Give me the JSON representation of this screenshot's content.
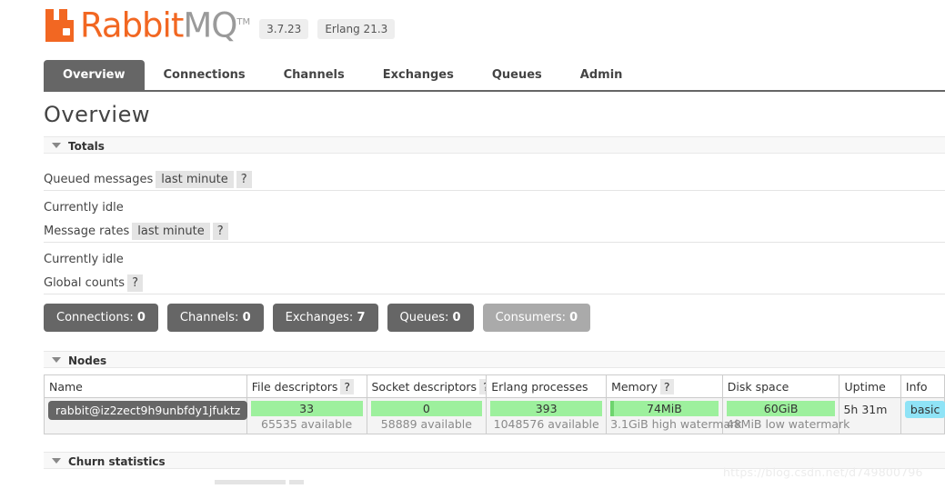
{
  "header": {
    "logo_rabbit": "Rabbit",
    "logo_mq": "MQ",
    "logo_tm": "TM",
    "version": "3.7.23",
    "erlang_version": "Erlang 21.3"
  },
  "tabs": [
    {
      "label": "Overview",
      "active": true
    },
    {
      "label": "Connections",
      "active": false
    },
    {
      "label": "Channels",
      "active": false
    },
    {
      "label": "Exchanges",
      "active": false
    },
    {
      "label": "Queues",
      "active": false
    },
    {
      "label": "Admin",
      "active": false
    }
  ],
  "page": {
    "title": "Overview"
  },
  "sections": {
    "totals": "Totals",
    "nodes": "Nodes",
    "churn": "Churn statistics"
  },
  "totals": {
    "queued_messages_label": "Queued messages",
    "queued_messages_period": "last minute",
    "queued_messages_help": "?",
    "queued_messages_status": "Currently idle",
    "message_rates_label": "Message rates",
    "message_rates_period": "last minute",
    "message_rates_help": "?",
    "message_rates_status": "Currently idle",
    "global_counts_label": "Global counts",
    "global_counts_help": "?"
  },
  "counts": [
    {
      "label": "Connections:",
      "value": "0",
      "muted": false
    },
    {
      "label": "Channels:",
      "value": "0",
      "muted": false
    },
    {
      "label": "Exchanges:",
      "value": "7",
      "muted": false
    },
    {
      "label": "Queues:",
      "value": "0",
      "muted": false
    },
    {
      "label": "Consumers:",
      "value": "0",
      "muted": true
    }
  ],
  "nodes_table": {
    "columns": [
      {
        "label": "Name",
        "help": ""
      },
      {
        "label": "File descriptors",
        "help": "?"
      },
      {
        "label": "Socket descriptors",
        "help": "?"
      },
      {
        "label": "Erlang processes",
        "help": ""
      },
      {
        "label": "Memory",
        "help": "?"
      },
      {
        "label": "Disk space",
        "help": ""
      },
      {
        "label": "Uptime",
        "help": ""
      },
      {
        "label": "Info",
        "help": ""
      }
    ],
    "row": {
      "name": "rabbit@iz2zect9h9unbfdy1jfuktz",
      "file_descriptors": "33",
      "file_descriptors_sub": "65535 available",
      "socket_descriptors": "0",
      "socket_descriptors_sub": "58889 available",
      "erlang_processes": "393",
      "erlang_processes_sub": "1048576 available",
      "memory": "74MiB",
      "memory_sub": "3.1GiB high watermark",
      "disk_space": "60GiB",
      "disk_space_sub": "48MiB low watermark",
      "uptime": "5h 31m",
      "info": "basic"
    }
  },
  "watermark": "https://blog.csdn.net/d749800796",
  "colors": {
    "brand_orange": "#f26722",
    "bar_green": "#9df09d",
    "bar_fill_green": "#6ed46e",
    "dark_gray": "#666666",
    "info_cyan": "#8fe3f6"
  }
}
